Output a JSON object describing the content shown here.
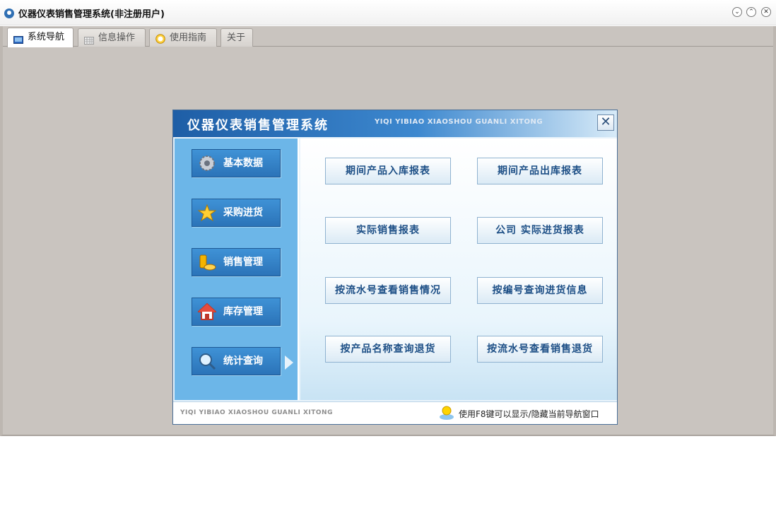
{
  "window": {
    "title": "仪器仪表销售管理系统(非注册用户)",
    "controls": [
      "minimize",
      "maximize",
      "close"
    ]
  },
  "tabs": [
    {
      "label": "系统导航",
      "icon": "monitor-icon",
      "active": true
    },
    {
      "label": "信息操作",
      "icon": "grid-icon",
      "active": false
    },
    {
      "label": "使用指南",
      "icon": "clock-icon",
      "active": false
    },
    {
      "label": "关于",
      "icon": "",
      "active": false
    }
  ],
  "panel": {
    "title": "仪器仪表销售管理系统",
    "pinyin": "YIQI YIBIAO XIAOSHOU GUANLI XITONG",
    "close_symbol": "✕"
  },
  "nav": [
    {
      "label": "基本数据",
      "icon": "gear-icon"
    },
    {
      "label": "采购进货",
      "icon": "star-icon"
    },
    {
      "label": "销售管理",
      "icon": "coins-icon"
    },
    {
      "label": "库存管理",
      "icon": "house-icon"
    },
    {
      "label": "统计查询",
      "icon": "magnifier-icon"
    }
  ],
  "reports": [
    "期间产品入库报表",
    "期间产品出库报表",
    "实际销售报表",
    "公司 实际进货报表",
    "按流水号查看销售情况",
    "按编号查询进货信息",
    "按产品名称查询退货",
    "按流水号查看销售退货"
  ],
  "footer": {
    "pinyin": "YIQI YIBIAO XIAOSHOU GUANLI XITONG",
    "tip": "使用F8键可以显示/隐藏当前导航窗口"
  },
  "colors": {
    "header_blue": "#1e5ea6",
    "nav_button": "#2b73b8",
    "left_column": "#6cb6e8",
    "report_text": "#1d4f86"
  }
}
